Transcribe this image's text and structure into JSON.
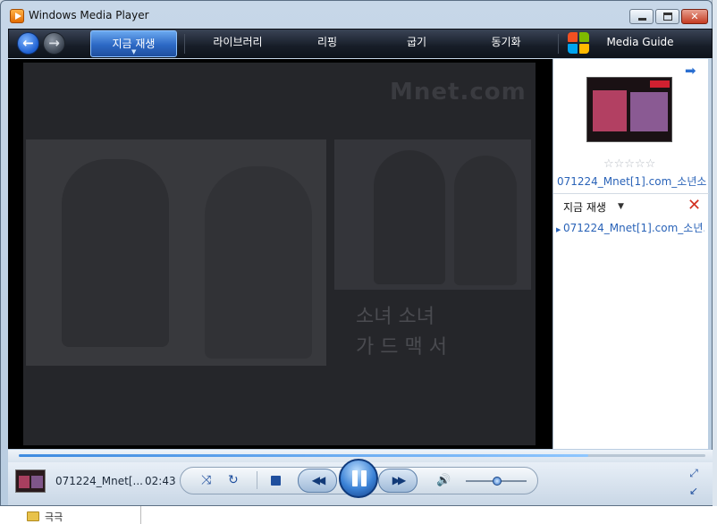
{
  "window": {
    "title": "Windows Media Player"
  },
  "nav": {
    "tabs": [
      {
        "label": "지금 재생",
        "active": true
      },
      {
        "label": "라이브러리"
      },
      {
        "label": "리핑"
      },
      {
        "label": "굽기"
      },
      {
        "label": "동기화"
      },
      {
        "label": "Media Guide"
      }
    ]
  },
  "video": {
    "logo_text": "Mnet.com",
    "caption_line1": "소녀 소녀",
    "caption_line2": "가 드 맥 서"
  },
  "sidebar": {
    "rating_stars": "☆☆☆☆☆",
    "media_title": "071224_Mnet[1].com_소년소...",
    "now_playing_label": "지금 재생",
    "playlist": [
      "071224_Mnet[1].com_소년..."
    ]
  },
  "seek": {
    "progress_fraction": 0.83
  },
  "player": {
    "track_name": "071224_Mnet[...",
    "time": "02:43",
    "volume_fraction": 0.52
  },
  "taskbar": {
    "folder_label": "극극"
  },
  "colors": {
    "accent": "#2c68c4",
    "link": "#2a63b8",
    "nav_bg": "#171d28"
  }
}
